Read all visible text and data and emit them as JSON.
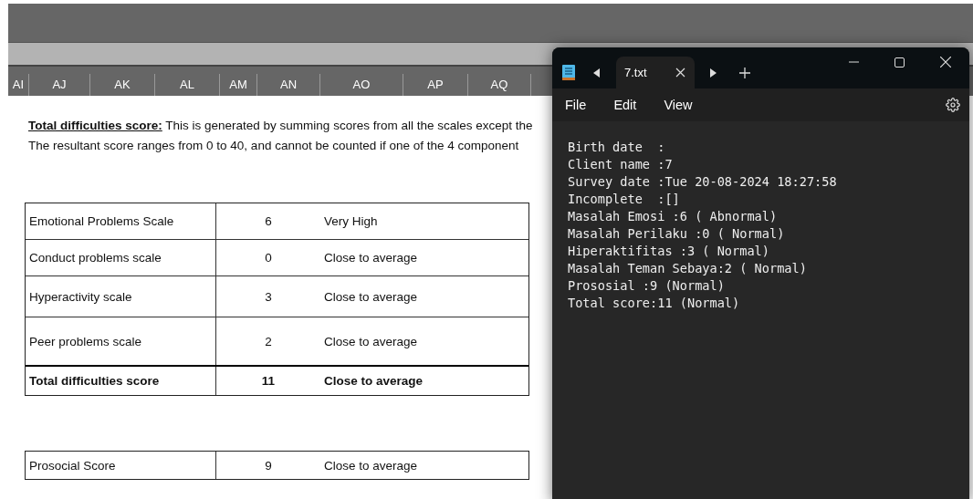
{
  "spreadsheet": {
    "column_headers": [
      "AI",
      "AJ",
      "AK",
      "AL",
      "AM",
      "AN",
      "AO",
      "AP",
      "AQ"
    ],
    "note": {
      "heading": "Total difficulties score:",
      "line_1": "This is generated by summing scores from all the scales except the",
      "line_2": "The resultant score ranges from 0 to 40, and cannot be counted if one of the 4 component"
    },
    "tables": [
      {
        "rows": [
          {
            "kind": "scale",
            "label": "Emotional Problems Scale",
            "score": "6",
            "band": "Very High"
          },
          {
            "kind": "scale",
            "label": "Conduct problems scale",
            "score": "0",
            "band": "Close to average"
          },
          {
            "kind": "scale",
            "label": "Hyperactivity scale",
            "score": "3",
            "band": "Close to average"
          },
          {
            "kind": "scale",
            "label": "Peer problems scale",
            "score": "2",
            "band": "Close to average"
          },
          {
            "kind": "total",
            "label": "Total difficulties score",
            "score": "11",
            "band": "Close to average"
          }
        ]
      },
      {
        "rows": [
          {
            "kind": "scale",
            "label": "Prosocial Score",
            "score": "9",
            "band": "Close to average"
          }
        ]
      }
    ]
  },
  "notepad": {
    "tabs": [
      {
        "label": "7.txt",
        "selected": true
      }
    ],
    "menu": [
      "File",
      "Edit",
      "View"
    ],
    "lines": [
      "Birth date  :",
      "Client name :7",
      "Survey date :Tue 20-08-2024 18:27:58",
      "Incomplete  :[]",
      "Masalah Emosi :6 ( Abnormal)",
      "Masalah Perilaku :0 ( Normal)",
      "Hiperaktifitas :3 ( Normal)",
      "Masalah Teman Sebaya:2 ( Normal)",
      "Prososial :9 (Normal)",
      "Total score:11 (Normal)"
    ]
  }
}
